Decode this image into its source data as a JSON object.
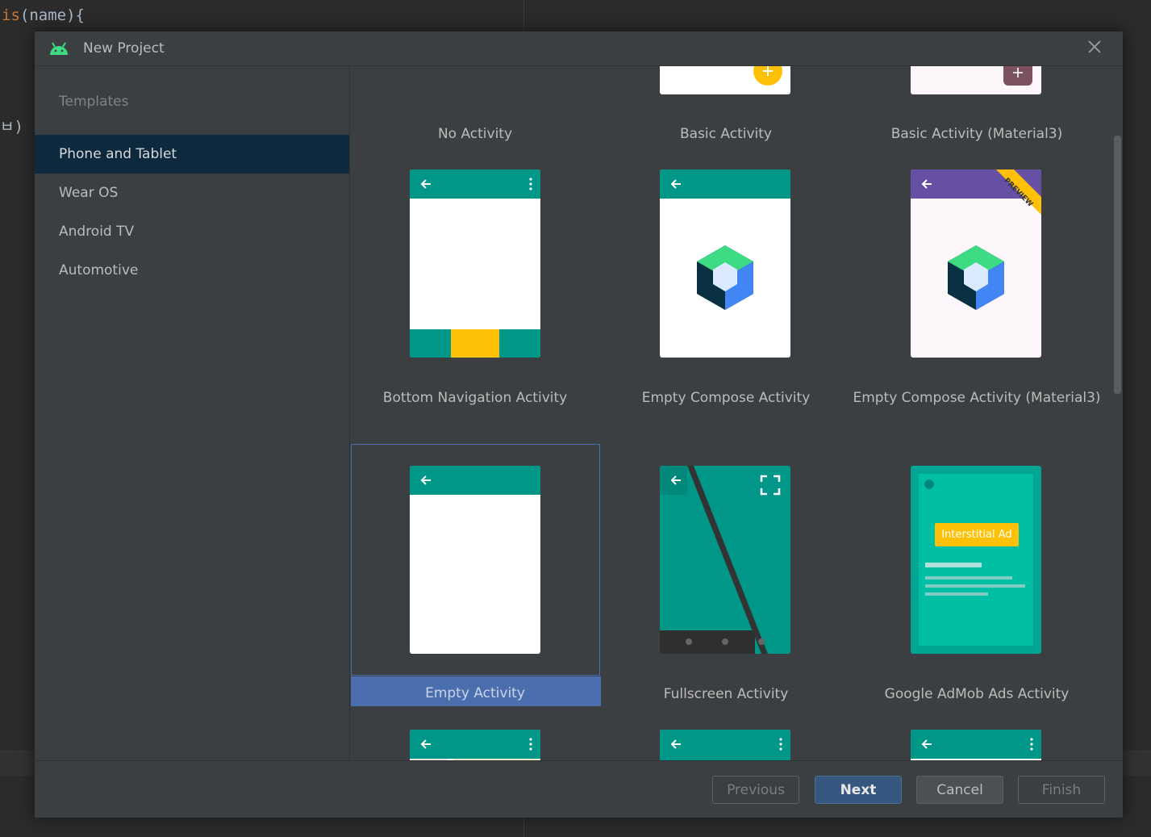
{
  "editor": {
    "code_line_1_keyword": "is",
    "code_line_1_rest": "(name){",
    "code_line_2": "ㅂ)"
  },
  "dialog": {
    "title": "New Project"
  },
  "sidebar": {
    "heading": "Templates",
    "items": [
      {
        "label": "Phone and Tablet",
        "selected": true
      },
      {
        "label": "Wear OS",
        "selected": false
      },
      {
        "label": "Android TV",
        "selected": false
      },
      {
        "label": "Automotive",
        "selected": false
      }
    ]
  },
  "templates": [
    {
      "label": "No Activity"
    },
    {
      "label": "Basic Activity"
    },
    {
      "label": "Basic Activity (Material3)"
    },
    {
      "label": "Bottom Navigation Activity"
    },
    {
      "label": "Empty Compose Activity"
    },
    {
      "label": "Empty Compose Activity (Material3)"
    },
    {
      "label": "Empty Activity",
      "selected": true
    },
    {
      "label": "Fullscreen Activity"
    },
    {
      "label": "Google AdMob Ads Activity"
    }
  ],
  "badges": {
    "preview": "PREVIEW",
    "interstitial": "Interstitial Ad"
  },
  "buttons": {
    "previous": "Previous",
    "next": "Next",
    "cancel": "Cancel",
    "finish": "Finish"
  },
  "colors": {
    "teal": "#009688",
    "purple": "#6650a4",
    "yellow": "#ffc107",
    "selection": "#4b6eaf",
    "sidebar_selected": "#0d293e"
  }
}
